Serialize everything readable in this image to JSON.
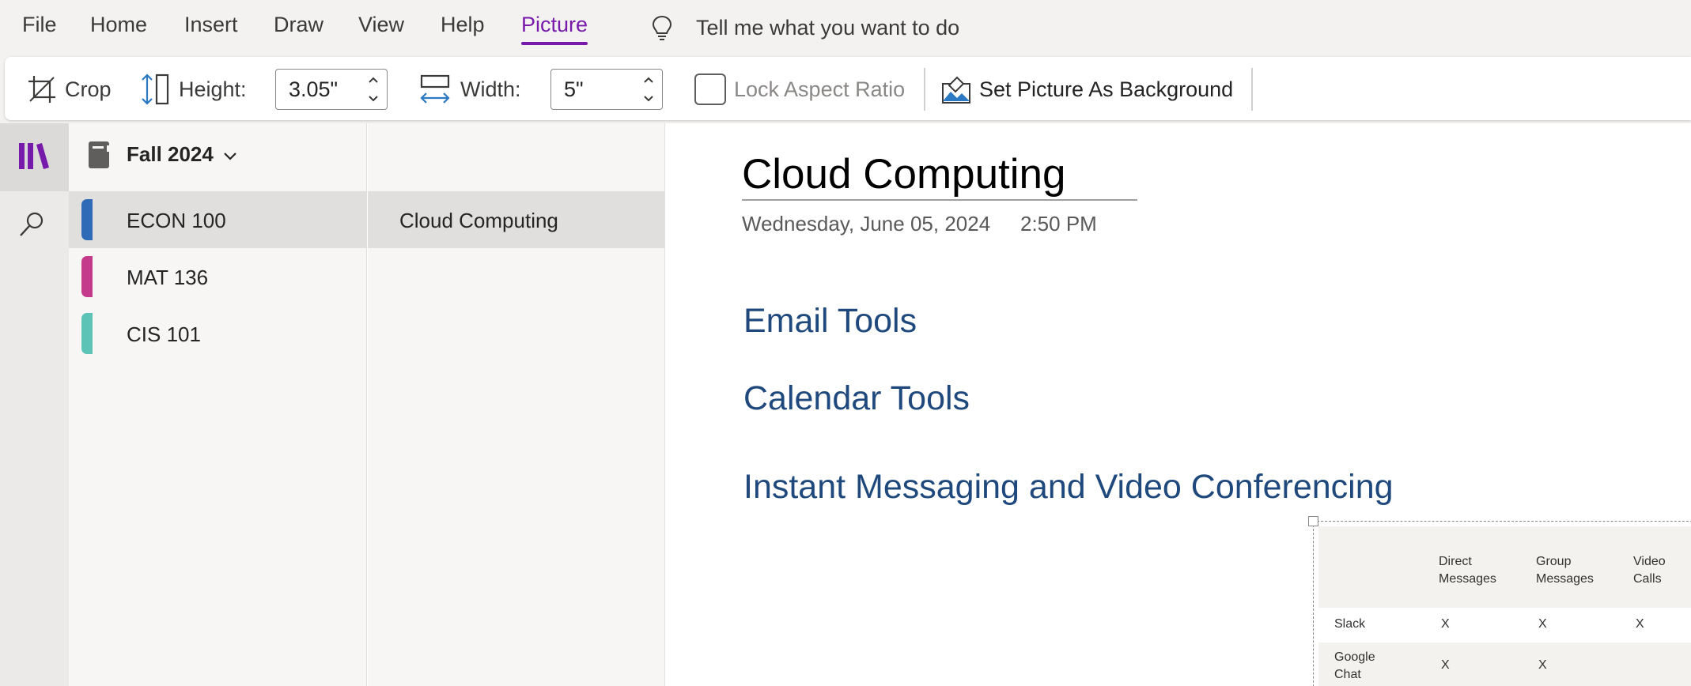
{
  "menu": {
    "items": [
      "File",
      "Home",
      "Insert",
      "Draw",
      "View",
      "Help",
      "Picture"
    ],
    "active": "Picture",
    "tell_me": "Tell me what you want to do"
  },
  "ribbon": {
    "crop_label": "Crop",
    "height_label": "Height:",
    "height_value": "3.05\"",
    "width_label": "Width:",
    "width_value": "5\"",
    "lock_aspect_label": "Lock Aspect Ratio",
    "lock_aspect_checked": false,
    "set_background_label": "Set Picture As Background"
  },
  "notebook": {
    "name": "Fall 2024",
    "sections": [
      {
        "label": "ECON 100",
        "color": "#2f6ab6",
        "selected": true
      },
      {
        "label": "MAT 136",
        "color": "#c53b8c",
        "selected": false
      },
      {
        "label": "CIS 101",
        "color": "#5cc3b6",
        "selected": false
      }
    ]
  },
  "pages": {
    "items": [
      {
        "label": "Cloud Computing",
        "selected": true
      }
    ]
  },
  "page": {
    "title": "Cloud Computing",
    "date": "Wednesday, June 05, 2024",
    "time": "2:50 PM",
    "headings": [
      "Email Tools",
      "Calendar Tools",
      "Instant Messaging and Video Conferencing"
    ]
  },
  "picture_table": {
    "headers": [
      "Direct\nMessages",
      "Group\nMessages",
      "Video\nCalls"
    ],
    "rows": [
      {
        "name": "Slack",
        "cells": [
          "X",
          "X",
          "X"
        ]
      },
      {
        "name": "Google\nChat",
        "cells": [
          "X",
          "X"
        ]
      }
    ]
  },
  "colors": {
    "accent": "#7719aa",
    "heading": "#1f497d"
  },
  "icons": {
    "lightbulb": "lightbulb-icon",
    "crop": "crop-icon",
    "height": "height-icon",
    "width": "width-icon",
    "background": "set-background-icon",
    "notebooks": "notebooks-icon",
    "search": "search-icon",
    "notebook": "notebook-icon",
    "dropdown": "chevron-down-icon"
  }
}
